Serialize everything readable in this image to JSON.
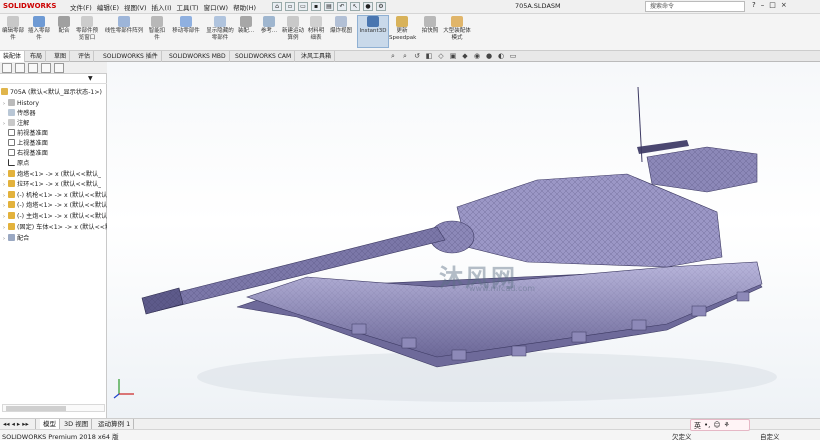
{
  "app": {
    "logo_text": "SOLIDWORKS",
    "document_title": "705A.SLDASM",
    "search_placeholder": "搜索命令"
  },
  "menu": [
    "文件(F)",
    "编辑(E)",
    "视图(V)",
    "插入(I)",
    "工具(T)",
    "窗口(W)",
    "帮助(H)"
  ],
  "window_controls": {
    "help": "?",
    "minimize": "–",
    "restore": "□",
    "close": "×"
  },
  "ribbon": {
    "buttons": [
      {
        "label": "编辑零部件"
      },
      {
        "label": "插入零部件"
      },
      {
        "label": "配合"
      },
      {
        "label": "零部件预览窗口"
      },
      {
        "label": "线性零部件阵列"
      },
      {
        "label": "智能扣件"
      },
      {
        "label": "移动零部件"
      },
      {
        "label": "显示隐藏的零部件"
      },
      {
        "label": "装配..."
      },
      {
        "label": "参考..."
      },
      {
        "label": "新建运动算例"
      },
      {
        "label": "材料明细表"
      },
      {
        "label": "爆炸视图"
      },
      {
        "label": "Instant3D"
      },
      {
        "label": "更新Speedpak"
      },
      {
        "label": "拍快照"
      },
      {
        "label": "大型装配体模式"
      }
    ]
  },
  "command_tabs": [
    "装配体",
    "布局",
    "草图",
    "评估",
    "SOLIDWORKS 插件",
    "SOLIDWORKS MBD",
    "SOLIDWORKS CAM",
    "沐风工具箱"
  ],
  "command_tabs_active": 0,
  "feature_tree": {
    "root": "705A (默认<默认_显示状态-1>)",
    "items": [
      {
        "label": "History",
        "icon": "history-icon"
      },
      {
        "label": "传感器",
        "icon": "sensor-icon"
      },
      {
        "label": "注解",
        "icon": "annotation-icon"
      },
      {
        "label": "前视基准面",
        "icon": "plane-icon"
      },
      {
        "label": "上视基准面",
        "icon": "plane-icon"
      },
      {
        "label": "右视基准面",
        "icon": "plane-icon"
      },
      {
        "label": "原点",
        "icon": "origin-icon"
      },
      {
        "label": "炮塔<1> -> x (默认<<默认_",
        "icon": "part-icon"
      },
      {
        "label": "拉环<1> -> x (默认<<默认_",
        "icon": "part-icon"
      },
      {
        "label": "(-) 机枪<1> -> x (默认<<默认",
        "icon": "part-icon"
      },
      {
        "label": "(-) 炮塔<1> -> x (默认<<默认",
        "icon": "part-icon"
      },
      {
        "label": "(-) 主炮<1> -> x (默认<<默认",
        "icon": "part-icon"
      },
      {
        "label": "(固定) 车体<1> -> x (默认<<默认",
        "icon": "part-icon"
      },
      {
        "label": "配合",
        "icon": "mate-icon"
      }
    ]
  },
  "bottom_tabs": [
    "模型",
    "3D 视图",
    "运动算例 1"
  ],
  "bottom_tabs_active": 0,
  "status": {
    "left": "SOLIDWORKS Premium 2018 x64 版",
    "right": "欠定义",
    "right2": "自定义"
  },
  "ime": {
    "lang": "英"
  },
  "watermark": {
    "text": "沐风网",
    "sub": "www.mfcad.com"
  },
  "colors": {
    "model": "#8c88b8",
    "model_dark": "#3d3a63",
    "accent": "#c00000"
  }
}
